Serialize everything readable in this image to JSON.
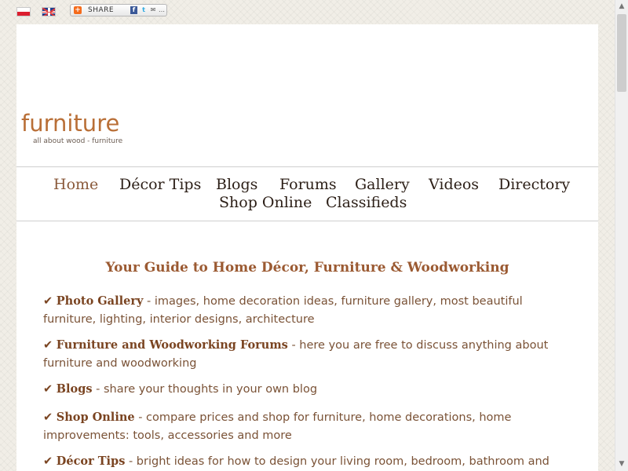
{
  "languages": [
    {
      "name": "pl-flag-icon"
    },
    {
      "name": "uk-flag-icon"
    }
  ],
  "share": {
    "label": "SHARE",
    "icons": [
      "share-plus-icon",
      "facebook-icon",
      "twitter-icon",
      "email-icon",
      "more-icon"
    ],
    "fb_glyph": "f",
    "tw_glyph": "t",
    "mail_glyph": "✉",
    "more_glyph": "…",
    "plus_glyph": "+"
  },
  "logo": {
    "text": "furniture",
    "tagline": "all about wood - furniture"
  },
  "nav": {
    "items": [
      {
        "label": "Home",
        "active": true
      },
      {
        "label": "Décor Tips"
      },
      {
        "label": "Blogs"
      },
      {
        "label": "Forums"
      },
      {
        "label": "Gallery"
      },
      {
        "label": "Videos"
      },
      {
        "label": "Directory"
      },
      {
        "label": "Shop Online"
      },
      {
        "label": "Classifieds"
      }
    ]
  },
  "main": {
    "heading": "Your Guide to Home Décor, Furniture & Woodworking",
    "check_glyph": "✔",
    "features": [
      {
        "title": "Photo Gallery",
        "desc": " - images, home decoration ideas, furniture gallery, most beautiful furniture, lighting, interior designs, architecture"
      },
      {
        "title": "Furniture and Woodworking Forums",
        "desc": " - here you are free to discuss anything about furniture and woodworking"
      },
      {
        "title": "Blogs",
        "desc": " - share your thoughts in your own blog"
      },
      {
        "title": "Shop Online",
        "desc": " - compare prices and shop for furniture, home decorations, home improvements: tools, accessories and more"
      },
      {
        "title": "Décor Tips",
        "desc": " - bright ideas for how to design your living room, bedroom, bathroom and"
      }
    ]
  },
  "colors": {
    "accent": "#b96f37",
    "heading": "#9b5a32",
    "text": "#7a5236",
    "background": "#f1eee7"
  }
}
